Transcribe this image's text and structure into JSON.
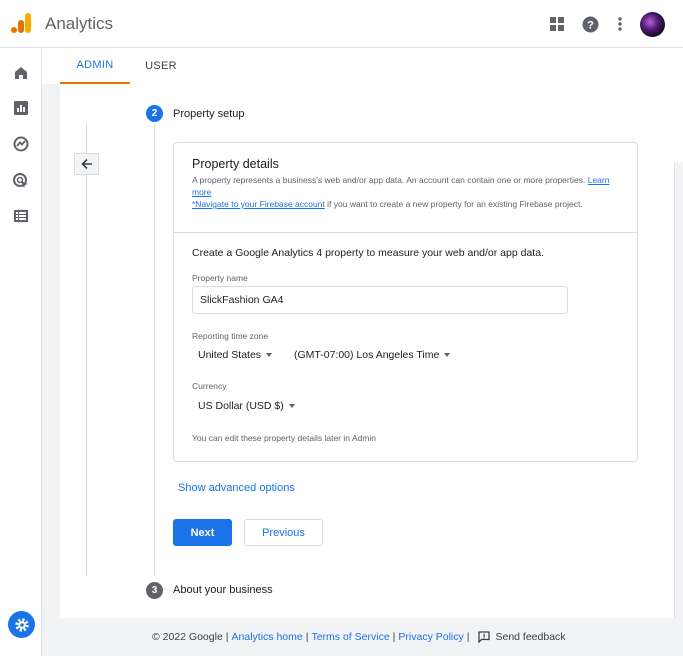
{
  "header": {
    "app_title": "Analytics",
    "icons": [
      "apps-grid-icon",
      "help-icon",
      "more-vert-icon"
    ],
    "brand_colors": {
      "orange": "#e37400",
      "yellow": "#f9ab00",
      "blue": "#1a73e8"
    }
  },
  "rail": {
    "icons": [
      "home-icon",
      "reports-icon",
      "explore-icon",
      "advertising-icon",
      "configure-icon",
      "settings-icon"
    ]
  },
  "tabs": [
    {
      "label": "ADMIN",
      "active": true
    },
    {
      "label": "USER",
      "active": false
    }
  ],
  "steps": {
    "current": {
      "number": "2",
      "label": "Property setup"
    },
    "next": {
      "number": "3",
      "label": "About your business"
    }
  },
  "card": {
    "title": "Property details",
    "desc_text": "A property represents a business's web and/or app data. An account can contain one or more properties.",
    "learn_more": "Learn more",
    "firebase_link": "*Navigate to your Firebase account",
    "firebase_text": " if you want to create a new property for an existing Firebase project.",
    "intro": "Create a Google Analytics 4 property to measure your web and/or app data.",
    "property_name_label": "Property name",
    "property_name_value": "SlickFashion GA4",
    "timezone_label": "Reporting time zone",
    "country": "United States",
    "timezone": "(GMT-07:00) Los Angeles Time",
    "currency_label": "Currency",
    "currency": "US Dollar (USD $)",
    "edit_note": "You can edit these property details later in Admin"
  },
  "actions": {
    "advanced": "Show advanced options",
    "next": "Next",
    "previous": "Previous"
  },
  "footer": {
    "copyright": "© 2022 Google",
    "analytics_home": "Analytics home",
    "terms": "Terms of Service",
    "privacy": "Privacy Policy",
    "feedback": "Send feedback"
  }
}
